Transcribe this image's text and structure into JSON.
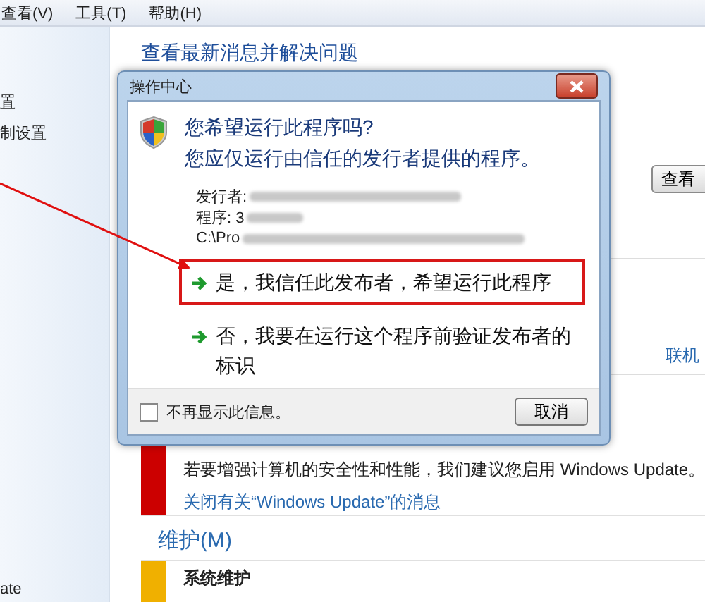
{
  "menu_bar": {
    "items": [
      "查看(V)",
      "工具(T)",
      "帮助(H)"
    ]
  },
  "sidebar": {
    "items": [
      "置",
      "制设置",
      "ate"
    ]
  },
  "content": {
    "title": "查看最新消息并解决问题",
    "side_button": "查看",
    "side_link": "联机",
    "messages": [
      {
        "color": "#cc0000",
        "text": "若要增强计算机的安全性和性能，我们建议您启用 Windows Update。",
        "link": "关闭有关“Windows Update”的消息"
      }
    ],
    "section": "维护(M)",
    "next_item": {
      "color": "#f0b000",
      "title": "系统维护"
    }
  },
  "dialog": {
    "title": "操作中心",
    "heading": [
      "您希望运行此程序吗?",
      "您应仅运行由信任的发行者提供的程序。"
    ],
    "details": [
      {
        "label": "发行者:",
        "blurred": true
      },
      {
        "label": "程序: 3",
        "blurred": true
      },
      {
        "label": "C:\\Pro",
        "blurred": true
      }
    ],
    "options": [
      {
        "text": "是，我信任此发布者，希望运行此程序",
        "highlighted": true
      },
      {
        "text": "否，我要在运行这个程序前验证发布者的标识",
        "highlighted": false
      }
    ],
    "checkbox": {
      "label": "不再显示此信息。",
      "checked": false
    },
    "cancel_button": "取消"
  }
}
